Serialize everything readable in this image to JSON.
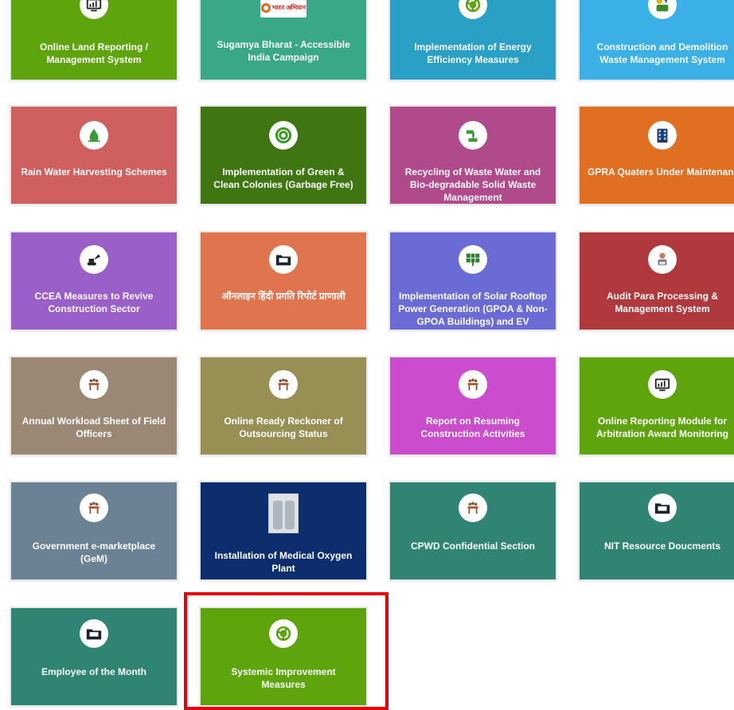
{
  "tiles": [
    {
      "label": "Online Land Reporting / Management System",
      "color": "#5ea40d",
      "icon": "monitor-chart-icon"
    },
    {
      "label": "Sugamya Bharat - Accessible India Campaign",
      "color": "#38a887",
      "icon": "accessible-india-logo",
      "logo_text": "भारत अभियान"
    },
    {
      "label": "Implementation of Energy Efficiency Measures",
      "color": "#2aa0c6",
      "icon": "recycle-icon"
    },
    {
      "label": "Construction and Demolition Waste Management System",
      "color": "#3ab0e6",
      "icon": "hazard-waste-icon"
    },
    {
      "label": "Rain Water Harvesting Schemes",
      "color": "#d05f5f",
      "icon": "water-drop-icon"
    },
    {
      "label": "Implementation of Green & Clean Colonies (Garbage Free)",
      "color": "#3f7612",
      "icon": "green-globe-icon"
    },
    {
      "label": "Recycling of Waste Water and Bio-degradable Solid Waste Management",
      "color": "#b04a8a",
      "icon": "water-tap-icon"
    },
    {
      "label": "GPRA Quaters Under Maintenance",
      "color": "#e06f22",
      "icon": "building-icon"
    },
    {
      "label": "CCEA Measures to Revive Construction Sector",
      "color": "#9a5fc8",
      "icon": "excavator-icon"
    },
    {
      "label": "ऑनलाइन हिंदी प्रगति रिपोर्ट प्राणाली",
      "color": "#df744e",
      "icon": "folder-icon"
    },
    {
      "label": "Implementation of Solar Rooftop Power Generation (GPOA & Non-GPOA Buildings) and EV Charging Station",
      "color": "#6b6bd6",
      "icon": "solar-panel-icon"
    },
    {
      "label": "Audit Para Processing & Management System",
      "color": "#b0393e",
      "icon": "auditor-icon"
    },
    {
      "label": "Annual Workload Sheet of Field Officers",
      "color": "#9a8774",
      "icon": "meeting-icon"
    },
    {
      "label": "Online Ready Reckoner of Outsourcing Status",
      "color": "#988f55",
      "icon": "meeting-icon"
    },
    {
      "label": "Report on Resuming Construction Activities",
      "color": "#cb4ccc",
      "icon": "meeting-icon"
    },
    {
      "label": "Online Reporting Module for Arbitration Award Monitoring",
      "color": "#5ea40d",
      "icon": "monitor-chart-icon"
    },
    {
      "label": "Government e-marketplace (GeM)",
      "color": "#6a8294",
      "icon": "meeting-icon"
    },
    {
      "label": "Installation of Medical Oxygen Plant",
      "color": "#0c2d6e",
      "icon": "oxygen-plant-photo"
    },
    {
      "label": "CPWD Confidential Section",
      "color": "#2f8473",
      "icon": "meeting-icon"
    },
    {
      "label": "NIT Resource Doucments",
      "color": "#2f8473",
      "icon": "folder-icon"
    },
    {
      "label": "Employee of the Month",
      "color": "#2f8473",
      "icon": "folder-icon"
    },
    {
      "label": "Systemic Improvement Measures",
      "color": "#5ea40d",
      "icon": "recycle-icon"
    }
  ],
  "highlight": {
    "label": "Systemic Improvement Measures",
    "color": "#e8000b"
  }
}
